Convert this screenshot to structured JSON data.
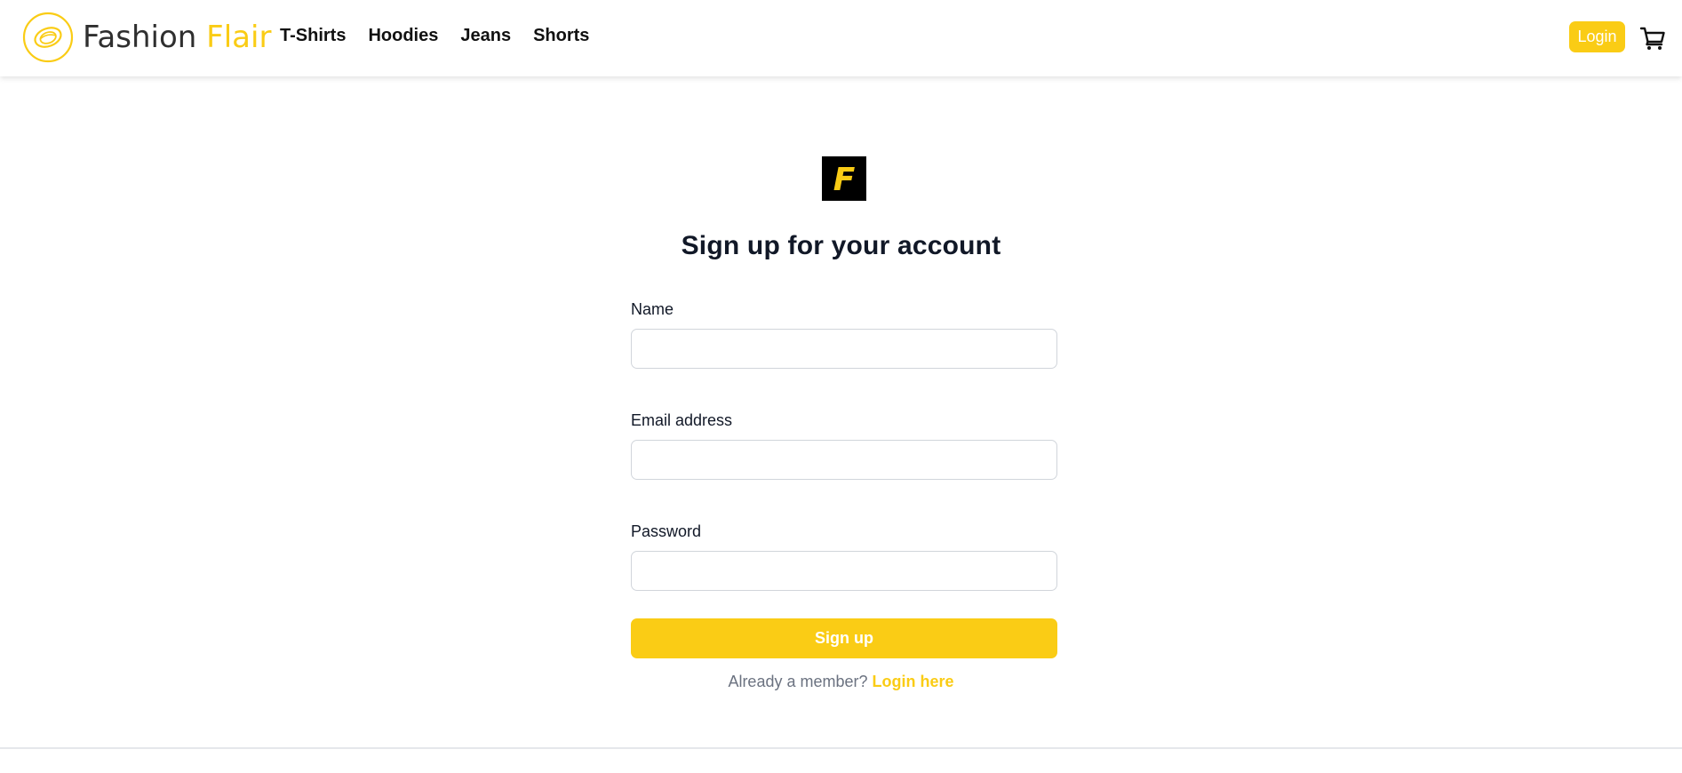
{
  "header": {
    "brand": {
      "name_part1": "Fashion",
      "name_part2": "Flair",
      "logo_icon": "ring-logo-icon"
    },
    "nav": [
      {
        "label": "T-Shirts"
      },
      {
        "label": "Hoodies"
      },
      {
        "label": "Jeans"
      },
      {
        "label": "Shorts"
      }
    ],
    "login_label": "Login",
    "cart_icon": "cart-icon"
  },
  "main": {
    "logo_letter": "F",
    "title": "Sign up for your account",
    "form": {
      "name_label": "Name",
      "name_value": "",
      "email_label": "Email address",
      "email_value": "",
      "password_label": "Password",
      "password_value": "",
      "submit_label": "Sign up"
    },
    "member_prompt": "Already a member?",
    "login_link": "Login here"
  },
  "colors": {
    "accent": "#facc15",
    "text": "#111827",
    "muted": "#6b7280",
    "input_border": "#d1d5db"
  }
}
